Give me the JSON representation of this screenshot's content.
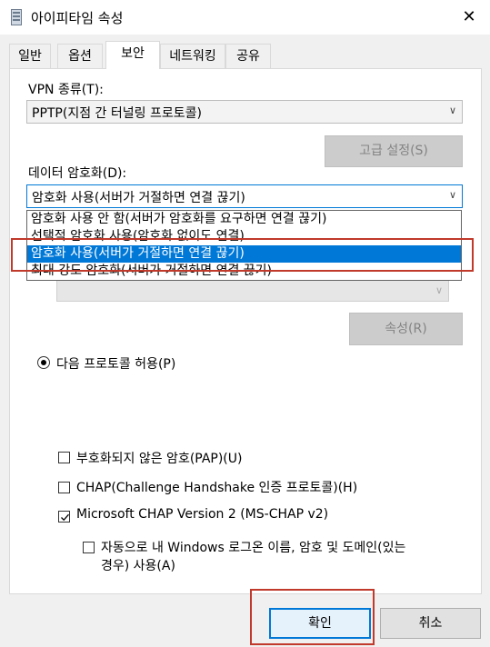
{
  "window": {
    "title": "아이피타임 속성",
    "close_symbol": "✕"
  },
  "tabs": [
    {
      "label": "일반"
    },
    {
      "label": "옵션"
    },
    {
      "label": "보안"
    },
    {
      "label": "네트워킹"
    },
    {
      "label": "공유"
    }
  ],
  "active_tab": "보안",
  "security": {
    "vpn_type_label": "VPN 종류(T):",
    "vpn_type_value": "PPTP(지점 간 터널링 프로토콜)",
    "advanced_button": "고급 설정(S)",
    "encryption_label": "데이터 암호화(D):",
    "encryption_value": "암호화 사용(서버가 거절하면 연결 끊기)",
    "encryption_options": [
      "암호화 사용 안 함(서버가 암호화를 요구하면 연결 끊기)",
      "선택적 암호화 사용(암호화 없이도 연결)",
      "암호화 사용(서버가 거절하면 연결 끊기)",
      "최대 강도 암호화(서버가 거절하면 연결 끊기)"
    ],
    "selected_option_index": 2,
    "properties_button": "속성(R)",
    "allow_protocols_label": "다음 프로토콜 허용(P)",
    "protocols": [
      {
        "label": "부호화되지 않은 암호(PAP)(U)",
        "checked": false
      },
      {
        "label": "CHAP(Challenge Handshake 인증 프로토콜)(H)",
        "checked": false
      },
      {
        "label": "Microsoft CHAP Version 2 (MS-CHAP v2)",
        "checked": true
      }
    ],
    "auto_logon_label_line1": "자동으로 내 Windows 로그온 이름, 암호 및 도메인(있는",
    "auto_logon_label_line2": "경우) 사용(A)",
    "auto_logon_checked": false
  },
  "footer": {
    "ok_button": "확인",
    "cancel_button": "취소"
  },
  "colors": {
    "accent": "#0078d7",
    "highlight_box": "#c0392b"
  }
}
